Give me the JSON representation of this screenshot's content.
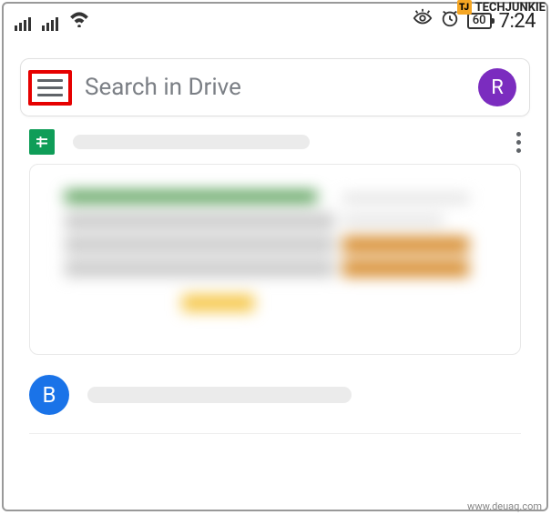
{
  "status_bar": {
    "battery_percent": "60",
    "time": "7:24"
  },
  "watermarks": {
    "top_logo_text": "TJ",
    "top_brand": "TECHJUNKIE",
    "bottom": "www.deuaq.com"
  },
  "search": {
    "placeholder": "Search in Drive",
    "avatar_initial": "R"
  },
  "items": [
    {
      "avatar_initial": "B"
    }
  ]
}
